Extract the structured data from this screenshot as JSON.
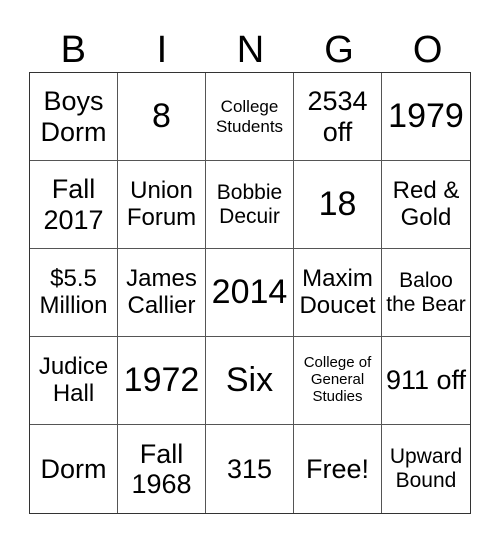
{
  "header": [
    "B",
    "I",
    "N",
    "G",
    "O"
  ],
  "cells": [
    "Boys Dorm",
    "8",
    "College Students",
    "2534 off",
    "1979",
    "Fall 2017",
    "Union Forum",
    "Bobbie Decuir",
    "18",
    "Red & Gold",
    "$5.5 Million",
    "James Callier",
    "2014",
    "Maxim Doucet",
    "Baloo the Bear",
    "Judice Hall",
    "1972",
    "Six",
    "College of General Studies",
    "911 off",
    "Dorm",
    "Fall 1968",
    "315",
    "Free!",
    "Upward Bound"
  ]
}
